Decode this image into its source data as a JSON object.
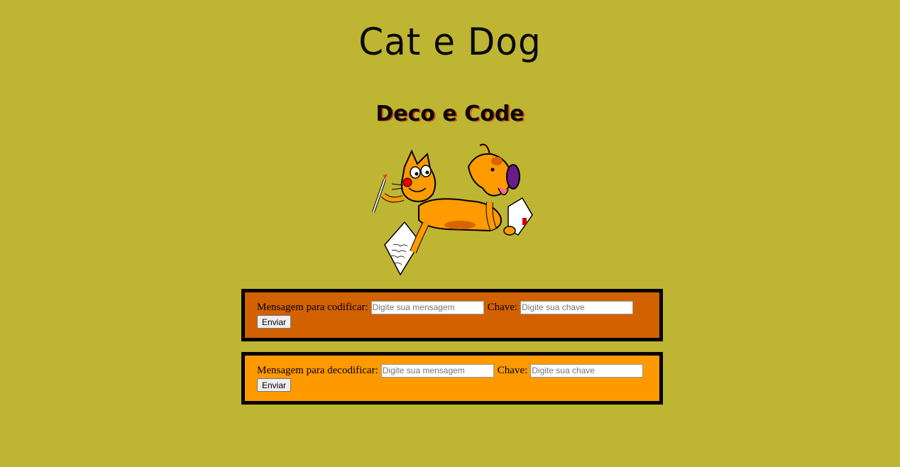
{
  "header": {
    "title": "Cat e Dog",
    "subtitle": "Deco e Code"
  },
  "encode_form": {
    "message_label": "Mensagem para codificar:",
    "message_placeholder": "Digite sua mensagem",
    "key_label": "Chave:",
    "key_placeholder": "Digite sua chave",
    "submit_label": "Enviar",
    "background": "#d26100"
  },
  "decode_form": {
    "message_label": "Mensagem para decodificar:",
    "message_placeholder": "Digite sua mensagem",
    "key_label": "Chave:",
    "key_placeholder": "Digite sua chave",
    "submit_label": "Enviar",
    "background": "#ff9900"
  },
  "colors": {
    "page_background": "#beb532",
    "border": "#000000"
  }
}
